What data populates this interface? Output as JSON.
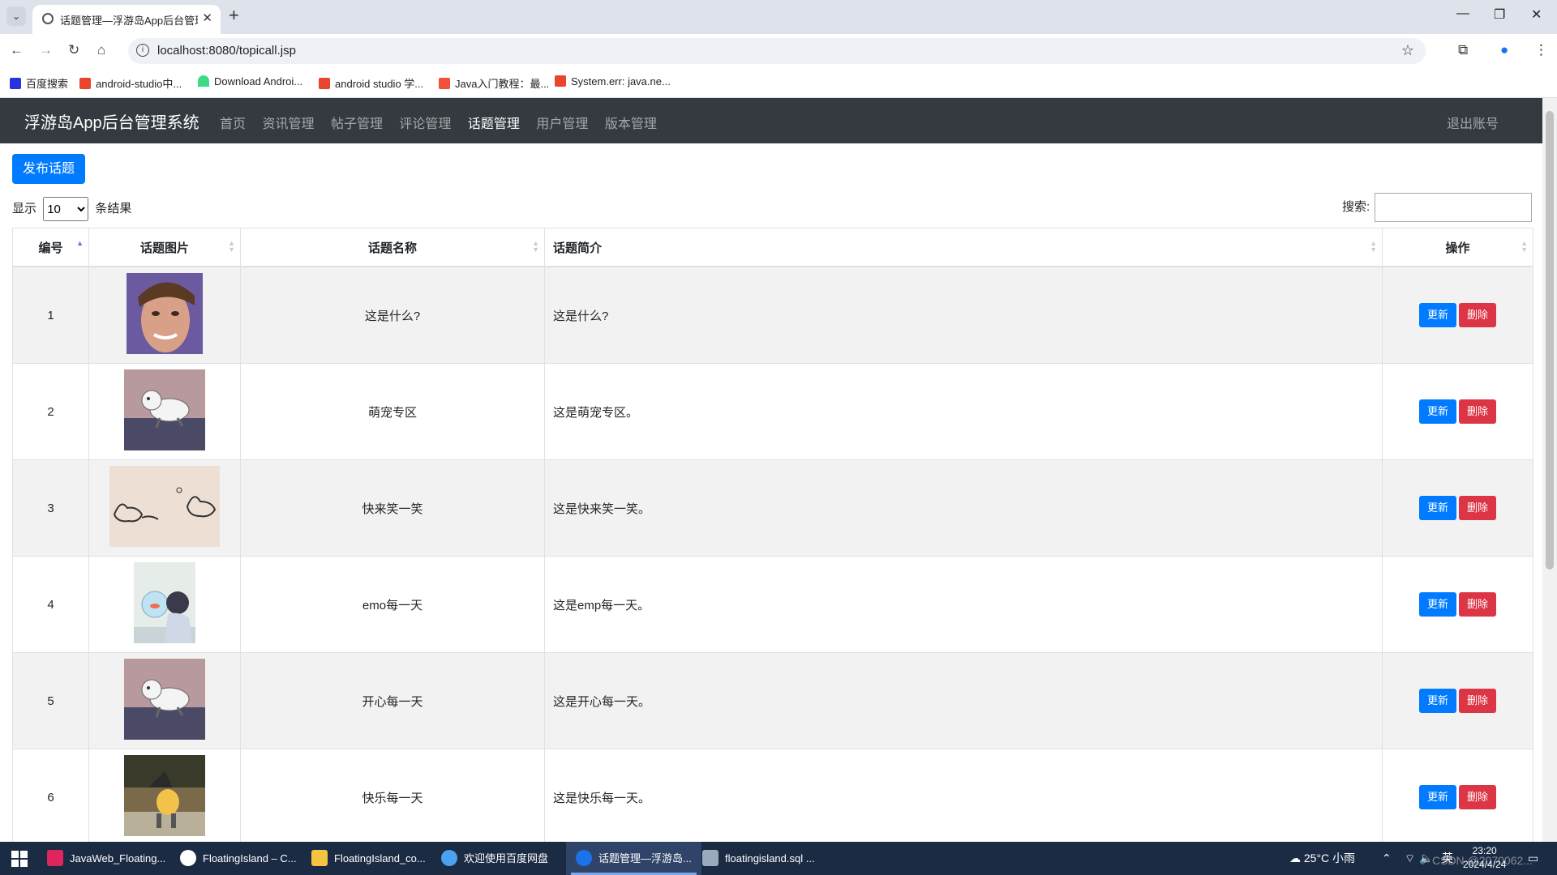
{
  "browser": {
    "tab_title": "话题管理—浮游岛App后台管理",
    "url": "localhost:8080/topicall.jsp",
    "bookmarks": [
      "百度搜索",
      "android-studio中...",
      "Download Androi...",
      "android studio 学...",
      "Java入门教程：最...",
      "System.err: java.ne..."
    ]
  },
  "nav": {
    "brand": "浮游岛App后台管理系统",
    "links": [
      "首页",
      "资讯管理",
      "帖子管理",
      "评论管理",
      "话题管理",
      "用户管理",
      "版本管理"
    ],
    "active_link": "话题管理",
    "logout": "退出账号"
  },
  "toolbar": {
    "publish_label": "发布话题",
    "show_label": "显示",
    "page_size": "10",
    "results_label": "条结果",
    "search_label": "搜索:"
  },
  "table": {
    "headers": [
      "编号",
      "话题图片",
      "话题名称",
      "话题简介",
      "操作"
    ],
    "rows": [
      {
        "id": "1",
        "name": "这是什么?",
        "intro": "这是什么?",
        "image": "portrait-face"
      },
      {
        "id": "2",
        "name": "萌宠专区",
        "intro": "这是萌宠专区。",
        "image": "cartoon-dog"
      },
      {
        "id": "3",
        "name": "快来笑一笑",
        "intro": "这是快来笑一笑。",
        "image": "cartoon-cats"
      },
      {
        "id": "4",
        "name": "emo每一天",
        "intro": "这是emp每一天。",
        "image": "boy-fishbowl"
      },
      {
        "id": "5",
        "name": "开心每一天",
        "intro": "这是开心每一天。",
        "image": "cartoon-dog"
      },
      {
        "id": "6",
        "name": "快乐每一天",
        "intro": "这是快乐每一天。",
        "image": "cartoon-character"
      }
    ],
    "update_label": "更新",
    "delete_label": "删除"
  },
  "taskbar": {
    "items": [
      "JavaWeb_Floating...",
      "FloatingIsland – C...",
      "FloatingIsland_co...",
      "欢迎使用百度网盘",
      "话题管理—浮游岛...",
      "floatingisland.sql ..."
    ],
    "weather": "25°C 小雨",
    "time": "23:20",
    "date": "2024/4/24",
    "ime": "英",
    "watermark": "CSDN @2070062..."
  },
  "colors": {
    "primary": "#007bff",
    "danger": "#dc3545",
    "navbar": "#343a40"
  }
}
